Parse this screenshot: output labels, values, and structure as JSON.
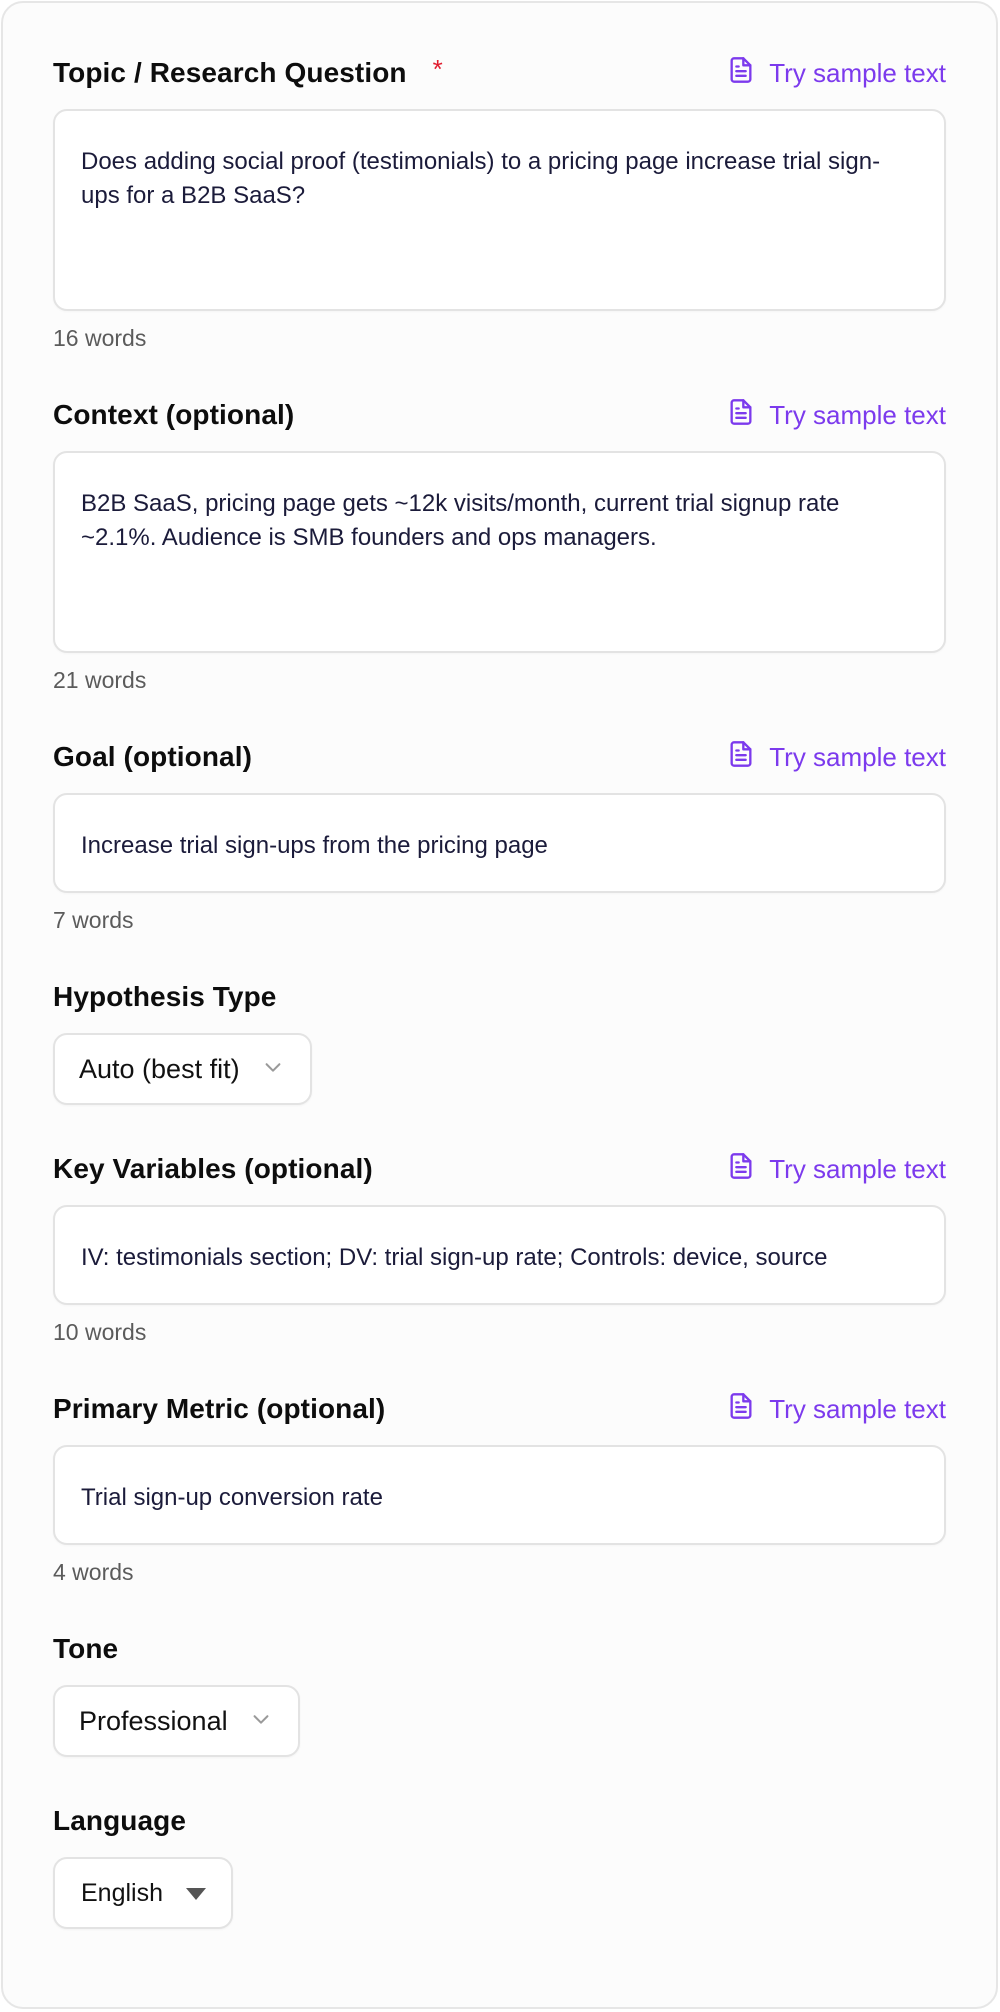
{
  "sample_link_label": "Try sample text",
  "fields": {
    "topic": {
      "label": "Topic / Research Question",
      "required_mark": "*",
      "value": "Does adding social proof (testimonials) to a pricing page increase trial sign-ups for a B2B SaaS?",
      "word_count": "16 words"
    },
    "context": {
      "label": "Context (optional)",
      "value": "B2B SaaS, pricing page gets ~12k visits/month, current trial signup rate ~2.1%. Audience is SMB founders and ops managers.",
      "word_count": "21 words"
    },
    "goal": {
      "label": "Goal (optional)",
      "value": "Increase trial sign-ups from the pricing page",
      "word_count": "7 words"
    },
    "hypothesis_type": {
      "label": "Hypothesis Type",
      "selected": "Auto (best fit)"
    },
    "key_variables": {
      "label": "Key Variables (optional)",
      "value": "IV: testimonials section; DV: trial sign-up rate; Controls: device, source",
      "word_count": "10 words"
    },
    "primary_metric": {
      "label": "Primary Metric (optional)",
      "value": "Trial sign-up conversion rate",
      "word_count": "4 words"
    },
    "tone": {
      "label": "Tone",
      "selected": "Professional"
    },
    "language": {
      "label": "Language",
      "selected": "English"
    }
  },
  "colors": {
    "accent": "#7c3aed",
    "required": "#e11d2f",
    "border": "#e3e3e3"
  },
  "icons": {
    "sample": "document-icon",
    "dropdown": "chevron-down-icon",
    "native_dropdown": "caret-down-icon"
  }
}
